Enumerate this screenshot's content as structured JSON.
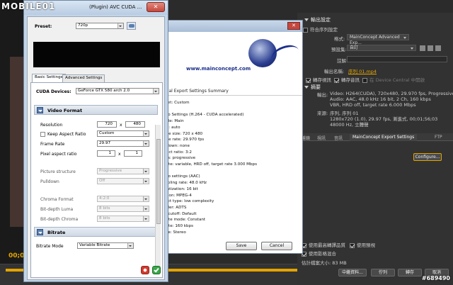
{
  "logo_text": "MOBILE01",
  "watermark": "#689490",
  "colors": {
    "accent": "#e3a400"
  },
  "background": {
    "timecode": "00;0",
    "export_settings": {
      "header": "輸出設定",
      "match_sequence": "符合序列設定",
      "format_label": "格式:",
      "format_value": "MainConcept Advanced Exp...",
      "preset_label": "預設集:",
      "preset_value": "自訂",
      "comment_label": "註解:",
      "output_name_label": "輸出名稱:",
      "output_name_value": "序列 01.mp4",
      "export_video": "轉存視訊",
      "export_audio": "轉存音訊",
      "device_central": "在 Device Central 中開啟",
      "summary_header": "摘要",
      "output_label": "輸出:",
      "output_line1": "Video: H264(CUDA), 720x480, 29.970 fps, Progressive",
      "output_line2": "Audio: AAC, 48.0 kHz 16 bit, 2 Ch, 160 kbps",
      "output_line3": "VBR, HRD off, target rate 6.000 Mbps",
      "source_label": "來源:",
      "source_line1": "序列, 序列 01",
      "source_line2": "1280x720 (1.0), 29.97 fps, 漸進式, 00;01;56;03",
      "source_line3": "48000 Hz, 立體聲"
    },
    "tabs": [
      "濾鏡",
      "視訊",
      "音訊",
      "MainConcept Export Settings",
      "FTP"
    ],
    "configure_button": "Configure...",
    "max_render_quality": "使用最高轉譯品質",
    "use_preview": "使用預視",
    "use_frame_blending": "使用影格混合",
    "estimated_size": "估計檔案大小: 83 MB",
    "metadata_button": "中繼資料...",
    "queue_button": "佇列",
    "export_button": "轉存",
    "cancel_button": "取消"
  },
  "summary_dialog": {
    "url": "www.mainconcept.com",
    "header": "Actual Export Settings Summary",
    "lines": [
      "Preset: Custom",
      "",
      "Video Settings (H.264 - CUDA accelerated)",
      "profile: Main",
      "level: auto",
      "frame size: 720 x 480",
      "frame rate: 29.970 fps",
      "pulldown: none",
      "aspect ratio: 3:2",
      "fields: progressive",
      "bitrate: variable, HRD off, target rate 3.000 Mbps",
      "",
      "Audio settings (AAC)",
      "sampling rate: 48.0 kHz",
      "quantization: 16 bit",
      "version: MPEG-4",
      "object type: low complexity",
      "header: ADTS",
      "LHF cutoff: Default",
      "bitrate mode: Constant",
      "bitrate: 160 kbps",
      "mode: Stereo",
      "",
      "Multiplexer Settings (MP4):"
    ],
    "save_button": "Save",
    "cancel_button": "Cancel",
    "close_glyph": "✕"
  },
  "avc_dialog": {
    "title": "(Plugin) AVC CUDA ...",
    "close_glyph": "✕",
    "preset_label": "Preset:",
    "preset_value": "720p",
    "tabs": [
      "Basic Settings",
      "Advanced Settings"
    ],
    "cuda_devices_label": "CUDA Devices:",
    "cuda_devices_value": "GeForce GTX 580 arch 2.0",
    "video_format_header": "Video Format",
    "resolution_label": "Resolution",
    "resolution_w": "720",
    "resolution_x": "x",
    "resolution_h": "480",
    "keep_aspect_label": "Keep Aspect Ratio",
    "keep_aspect_value": "Custom",
    "frame_rate_label": "Frame Rate",
    "frame_rate_value": "29.97",
    "pixel_aspect_label": "Pixel aspect ratio",
    "pixel_aspect_a": "1",
    "pixel_aspect_x": "x",
    "pixel_aspect_b": "1",
    "picture_structure_label": "Picture structure",
    "picture_structure_value": "Progressive",
    "pulldown_label": "Pulldown",
    "pulldown_value": "Off",
    "chroma_format_label": "Chroma Format",
    "chroma_format_value": "4:2:0",
    "bit_depth_luma_label": "Bit-depth Luma",
    "bit_depth_luma_value": "8 bits",
    "bit_depth_chroma_label": "Bit-depth Chroma",
    "bit_depth_chroma_value": "8 bits",
    "bitrate_header": "Bitrate",
    "bitrate_mode_label": "Bitrate Mode",
    "bitrate_mode_value": "Variable Bitrate"
  }
}
